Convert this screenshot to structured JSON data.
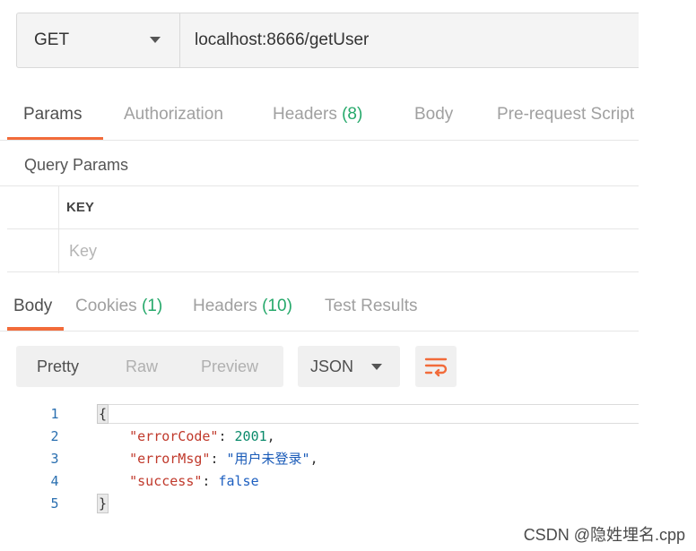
{
  "request": {
    "method": "GET",
    "url": "localhost:8666/getUser"
  },
  "request_tabs": [
    {
      "label": "Params",
      "count": ""
    },
    {
      "label": "Authorization",
      "count": ""
    },
    {
      "label": "Headers",
      "count": "(8)"
    },
    {
      "label": "Body",
      "count": ""
    },
    {
      "label": "Pre-request Script",
      "count": ""
    }
  ],
  "query_params": {
    "title": "Query Params",
    "column_key": "KEY",
    "key_placeholder": "Key"
  },
  "response_tabs": [
    {
      "label": "Body",
      "count": ""
    },
    {
      "label": "Cookies",
      "count": "(1)"
    },
    {
      "label": "Headers",
      "count": "(10)"
    },
    {
      "label": "Test Results",
      "count": ""
    }
  ],
  "view_modes": [
    "Pretty",
    "Raw",
    "Preview"
  ],
  "format": "JSON",
  "icons": {
    "dropdown": "chevron-down-icon",
    "wrap": "wrap-lines-icon"
  },
  "colors": {
    "accent": "#f26b3a",
    "count": "#26a96b"
  },
  "code": {
    "line_numbers": [
      "1",
      "2",
      "3",
      "4",
      "5"
    ],
    "open_brace": "{",
    "close_brace": "}",
    "fields": [
      {
        "key": "\"errorCode\"",
        "value": "2001",
        "suffix": ","
      },
      {
        "key": "\"errorMsg\"",
        "value": "\"用户未登录\"",
        "suffix": ","
      },
      {
        "key": "\"success\"",
        "value": "false",
        "suffix": ""
      }
    ]
  },
  "watermark": "CSDN @隐姓埋名.cpp"
}
